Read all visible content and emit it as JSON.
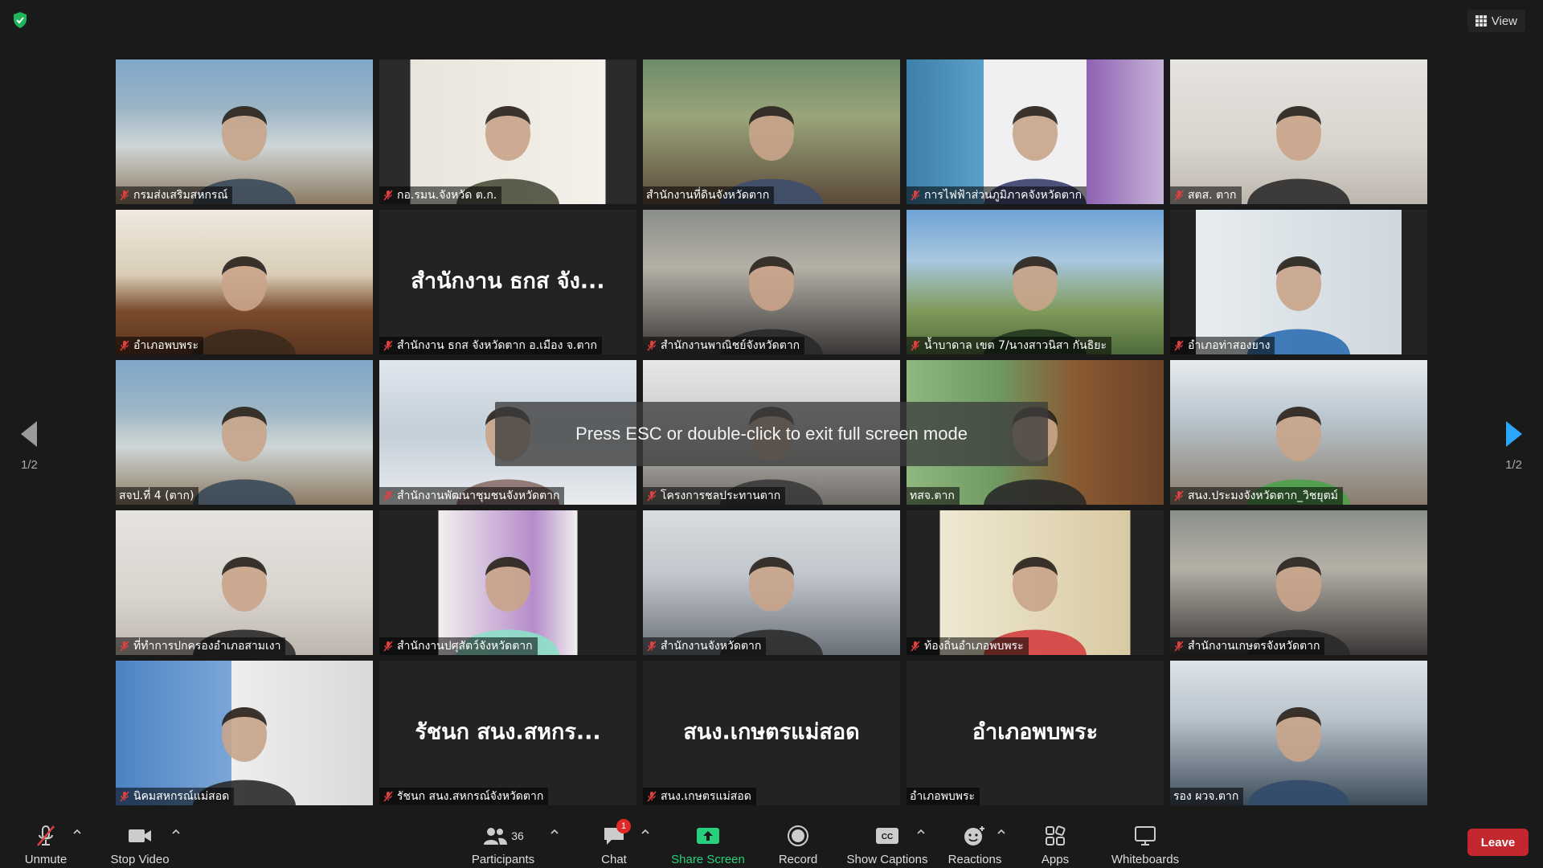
{
  "top": {
    "view_label": "View"
  },
  "overlay": {
    "fullscreen_message": "Press ESC or double-click to exit full screen mode"
  },
  "pagination": {
    "left_page": "1/2",
    "right_page": "1/2"
  },
  "tiles": [
    {
      "name": "กรมส่งเสริมสหกรณ์",
      "muted": true,
      "video": true,
      "scene": "meeting-room"
    },
    {
      "name": "กอ.รมน.จังหวัด ต.ก.",
      "muted": true,
      "video": true,
      "scene": "sign-board"
    },
    {
      "name": "สำนักงานที่ดินจังหวัดตาก",
      "muted": false,
      "video": true,
      "scene": "backdrop-person"
    },
    {
      "name": "การไฟฟ้าส่วนภูมิภาคจังหวัดตาก",
      "muted": true,
      "video": true,
      "scene": "pea"
    },
    {
      "name": "สตส. ตาก",
      "muted": true,
      "video": true,
      "scene": "office-person"
    },
    {
      "name": "อำเภอพบพระ",
      "muted": true,
      "video": true,
      "scene": "conference-hall"
    },
    {
      "name": "สำนักงาน ธกส จังหวัดตาก อ.เมือง จ.ตาก",
      "muted": true,
      "video": false,
      "big_name": "สำนักงาน ธกส จัง..."
    },
    {
      "name": "สำนักงานพาณิชย์จังหวัดตาก",
      "muted": true,
      "video": true,
      "scene": "close-person"
    },
    {
      "name": "น้ำบาดาล เขต 7/นางสาวนิสา กันธิยะ",
      "muted": true,
      "video": true,
      "scene": "banner-person"
    },
    {
      "name": "อำเภอท่าสองยาง",
      "muted": true,
      "video": true,
      "scene": "long-table"
    },
    {
      "name": "สจป.ที่ 4 (ตาก)",
      "muted": false,
      "video": true,
      "scene": "meeting-room"
    },
    {
      "name": "สำนักงานพัฒนาชุมชนจังหวัดตาก",
      "muted": true,
      "video": true,
      "scene": "curtain-room"
    },
    {
      "name": "โครงการชลประทานตาก",
      "muted": true,
      "video": true,
      "scene": "dim-person"
    },
    {
      "name": "ทสจ.ตาก",
      "muted": false,
      "video": true,
      "active": true,
      "scene": "wood-person"
    },
    {
      "name": "สนง.ประมงจังหวัดตาก_วิชยุตม์",
      "muted": true,
      "video": true,
      "scene": "outdoor-person"
    },
    {
      "name": "ที่ทำการปกครองอำเภอสามเงา",
      "muted": true,
      "video": true,
      "scene": "office-person"
    },
    {
      "name": "สำนักงานปศุสัตว์จังหวัดตาก",
      "muted": true,
      "video": true,
      "scene": "mint-person"
    },
    {
      "name": "สำนักงานจังหวัดตาก",
      "muted": true,
      "video": true,
      "scene": "glasses-person"
    },
    {
      "name": "ท้องถิ่นอำเภอพบพระ",
      "muted": true,
      "video": true,
      "scene": "woman-glasses"
    },
    {
      "name": "สำนักงานเกษตรจังหวัดตาก",
      "muted": true,
      "video": true,
      "scene": "close-person"
    },
    {
      "name": "นิคมสหกรณ์แม่สอด",
      "muted": true,
      "video": true,
      "scene": "portrait-person"
    },
    {
      "name": "รัชนก สนง.สหกรณ์จังหวัดตาก",
      "muted": true,
      "video": false,
      "big_name": "รัชนก สนง.สหกร..."
    },
    {
      "name": "สนง.เกษตรแม่สอด",
      "muted": true,
      "video": false,
      "big_name": "สนง.เกษตรแม่สอด"
    },
    {
      "name": "อำเภอพบพระ",
      "muted": false,
      "video": false,
      "big_name": "อำเภอพบพระ"
    },
    {
      "name": "รอง ผวจ.ตาก",
      "muted": false,
      "video": true,
      "scene": "man-desk"
    }
  ],
  "toolbar": {
    "unmute": "Unmute",
    "stop_video": "Stop Video",
    "participants": "Participants",
    "participants_count": "36",
    "chat": "Chat",
    "chat_badge": "1",
    "share_screen": "Share Screen",
    "record": "Record",
    "show_captions": "Show Captions",
    "reactions": "Reactions",
    "apps": "Apps",
    "whiteboards": "Whiteboards",
    "leave": "Leave"
  },
  "colors": {
    "share_green": "#26d07c",
    "leave_red": "#c1272d",
    "active_speaker": "#d6e36a",
    "mute_red": "#e04040",
    "nav_blue": "#2aa8ff"
  }
}
